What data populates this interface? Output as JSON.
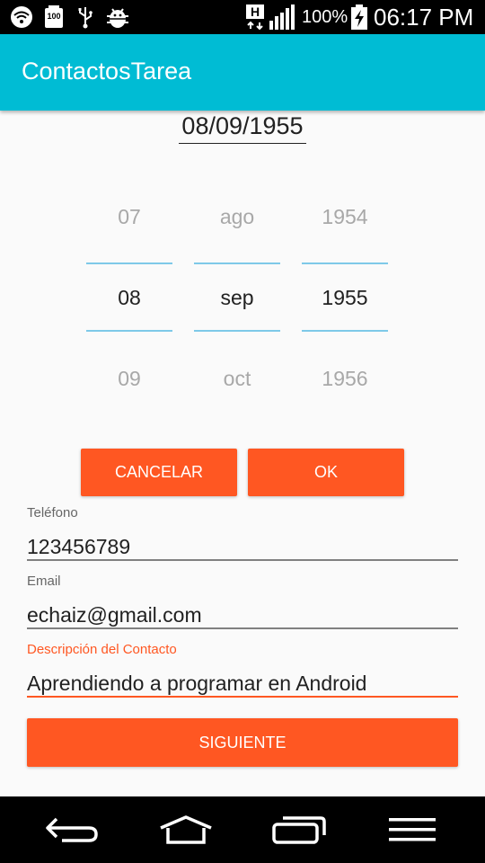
{
  "status_bar": {
    "battery_text": "100%",
    "time": "06:17 PM",
    "network_letter": "H",
    "notification_badge": "100",
    "icons": [
      "wifi-icon",
      "notification-icon",
      "usb-icon",
      "android-debug-icon",
      "network-h-icon",
      "signal-icon",
      "battery-charging-icon"
    ]
  },
  "app_bar": {
    "title": "ContactosTarea",
    "color": "#00bcd4"
  },
  "date_picker": {
    "selected_date": "08/09/1955",
    "day": {
      "prev": "07",
      "current": "08",
      "next": "09"
    },
    "month": {
      "prev": "ago",
      "current": "sep",
      "next": "oct"
    },
    "year": {
      "prev": "1954",
      "current": "1955",
      "next": "1956"
    },
    "cancel_label": "CANCELAR",
    "ok_label": "OK"
  },
  "form": {
    "phone": {
      "label": "Teléfono",
      "value": "123456789"
    },
    "email": {
      "label": "Email",
      "value": "echaiz@gmail.com"
    },
    "description": {
      "label": "Descripción del Contacto",
      "value": "Aprendiendo a programar en Android"
    },
    "next_label": "SIGUIENTE"
  },
  "accent_color": "#ff5722",
  "nav_bar": {
    "icons": [
      "back-icon",
      "home-icon",
      "recent-apps-icon",
      "menu-icon"
    ]
  }
}
